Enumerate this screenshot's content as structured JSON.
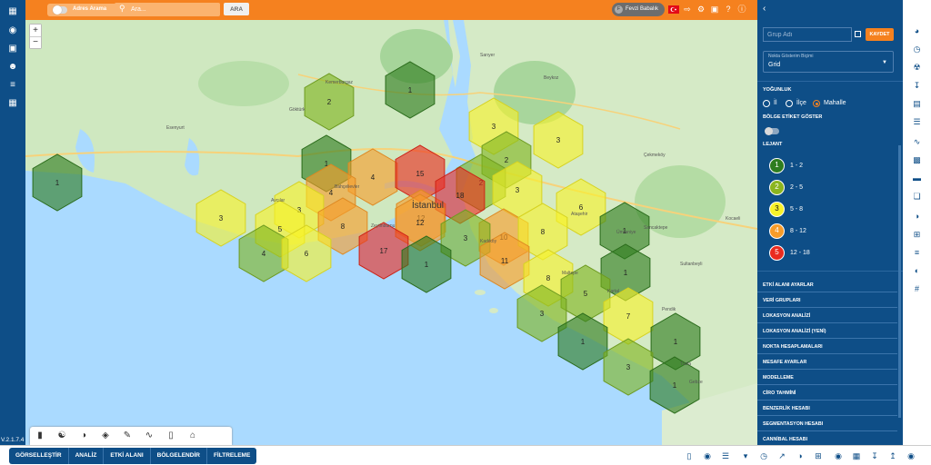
{
  "app": {
    "version": "V.2.1.7.4"
  },
  "topbar": {
    "address_search_label": "Adres Arama",
    "search_placeholder": "Ara...",
    "search_button": "ARA",
    "user_initial": "F",
    "user_name": "Fevzi Babalık"
  },
  "map": {
    "zoom_in": "+",
    "zoom_out": "−",
    "city_label": "İstanbul",
    "places": [
      {
        "name": "Kemerburgaz"
      },
      {
        "name": "Göktürk"
      },
      {
        "name": "Sarıyer"
      },
      {
        "name": "Beykoz"
      },
      {
        "name": "Esenyurt"
      },
      {
        "name": "Avcılar"
      },
      {
        "name": "Zeytinburnu"
      },
      {
        "name": "Bahçelievler"
      },
      {
        "name": "Kadıköy"
      },
      {
        "name": "Ataşehir"
      },
      {
        "name": "Ümraniye"
      },
      {
        "name": "Maltepe"
      },
      {
        "name": "Kartal"
      },
      {
        "name": "Pendik"
      },
      {
        "name": "Sultanbeyli"
      },
      {
        "name": "Tuzla"
      },
      {
        "name": "Gebze"
      },
      {
        "name": "Çekmeköy"
      },
      {
        "name": "Kocaeli"
      },
      {
        "name": "Sancaktepe"
      }
    ],
    "hexes": [
      {
        "value": "1",
        "level": 1
      },
      {
        "value": "1",
        "level": 1
      },
      {
        "value": "2",
        "level": 2
      },
      {
        "value": "3",
        "level": 3
      },
      {
        "value": "3",
        "level": 3
      },
      {
        "value": "2",
        "level": 2
      },
      {
        "value": "1",
        "level": 1
      },
      {
        "value": "4",
        "level": 4
      },
      {
        "value": "15",
        "level": 5
      },
      {
        "value": "2",
        "level": 2
      },
      {
        "value": "3",
        "level": 3
      },
      {
        "value": "3",
        "level": 3
      },
      {
        "value": "4",
        "level": 4
      },
      {
        "value": "12",
        "level": 4
      },
      {
        "value": "18",
        "level": 5
      },
      {
        "value": "3",
        "level": 3
      },
      {
        "value": "5",
        "level": 3
      },
      {
        "value": "8",
        "level": 4
      },
      {
        "value": "12",
        "level": 4
      },
      {
        "value": "10",
        "level": 4
      },
      {
        "value": "6",
        "level": 3
      },
      {
        "value": "4",
        "level": 2
      },
      {
        "value": "6",
        "level": 3
      },
      {
        "value": "17",
        "level": 5
      },
      {
        "value": "3",
        "level": 2
      },
      {
        "value": "8",
        "level": 3
      },
      {
        "value": "1",
        "level": 1
      },
      {
        "value": "1",
        "level": 1
      },
      {
        "value": "11",
        "level": 4
      },
      {
        "value": "1",
        "level": 1
      },
      {
        "value": "8",
        "level": 3
      },
      {
        "value": "5",
        "level": 2
      },
      {
        "value": "3",
        "level": 2
      },
      {
        "value": "7",
        "level": 3
      },
      {
        "value": "1",
        "level": 1
      },
      {
        "value": "1",
        "level": 1
      },
      {
        "value": "3",
        "level": 2
      },
      {
        "value": "1",
        "level": 1
      }
    ]
  },
  "panel": {
    "group_placeholder": "Grup Adı",
    "save_button": "KAYDET",
    "display_label": "Nokta Gösterim Biçimi",
    "display_value": "Grid",
    "density_title": "YOĞUNLUK",
    "radio_options": [
      {
        "label": "İl",
        "selected": false
      },
      {
        "label": "İlçe",
        "selected": false
      },
      {
        "label": "Mahalle",
        "selected": true
      }
    ],
    "region_label_title": "BÖLGE ETİKET GÖSTER",
    "legend_title": "LEJANT",
    "legend": [
      {
        "num": "1",
        "range": "1 - 2",
        "color": "#2e7d1f"
      },
      {
        "num": "2",
        "range": "2 - 5",
        "color": "#8bb51f"
      },
      {
        "num": "3",
        "range": "5 - 8",
        "color": "#f7f22a"
      },
      {
        "num": "4",
        "range": "8 - 12",
        "color": "#f79c2a"
      },
      {
        "num": "5",
        "range": "12 - 18",
        "color": "#ea2b1f"
      }
    ],
    "menu": [
      "ETKİ ALANI AYARLAR",
      "VERİ GRUPLARI",
      "LOKASYON ANALİZİ",
      "LOKASYON ANALİZİ (YENİ)",
      "NOKTA HESAPLAMALARI",
      "MESAFE AYARLAR",
      "MODELLEME",
      "CİRO TAHMİNİ",
      "BENZERLİK HESABI",
      "SEGMENTASYON HESABI",
      "CANNİBAL HESABI"
    ]
  },
  "bottom_tabs": [
    "GÖRSELLEŞTİR",
    "ANALİZ",
    "ETKİ ALANI",
    "BÖLGELENDİR",
    "FİLTRELEME"
  ],
  "colors": {
    "brand_orange": "#f5811f",
    "brand_blue": "#0e4e87"
  }
}
